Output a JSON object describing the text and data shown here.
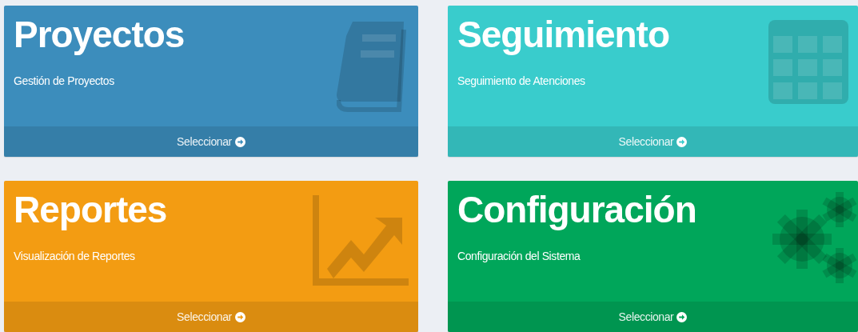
{
  "cards": [
    {
      "title": "Proyectos",
      "subtitle": "Gestión de Proyectos",
      "action": "Seleccionar",
      "kind": "book",
      "color": "#3c8dbc"
    },
    {
      "title": "Seguimiento",
      "subtitle": "Seguimiento de Atenciones",
      "action": "Seleccionar",
      "kind": "grid",
      "color": "#39cccc"
    },
    {
      "title": "Reportes",
      "subtitle": "Visualización de Reportes",
      "action": "Seleccionar",
      "kind": "chart",
      "color": "#f39c12"
    },
    {
      "title": "Configuración",
      "subtitle": "Configuración del Sistema",
      "action": "Seleccionar",
      "kind": "gears",
      "color": "#00a65a"
    }
  ]
}
